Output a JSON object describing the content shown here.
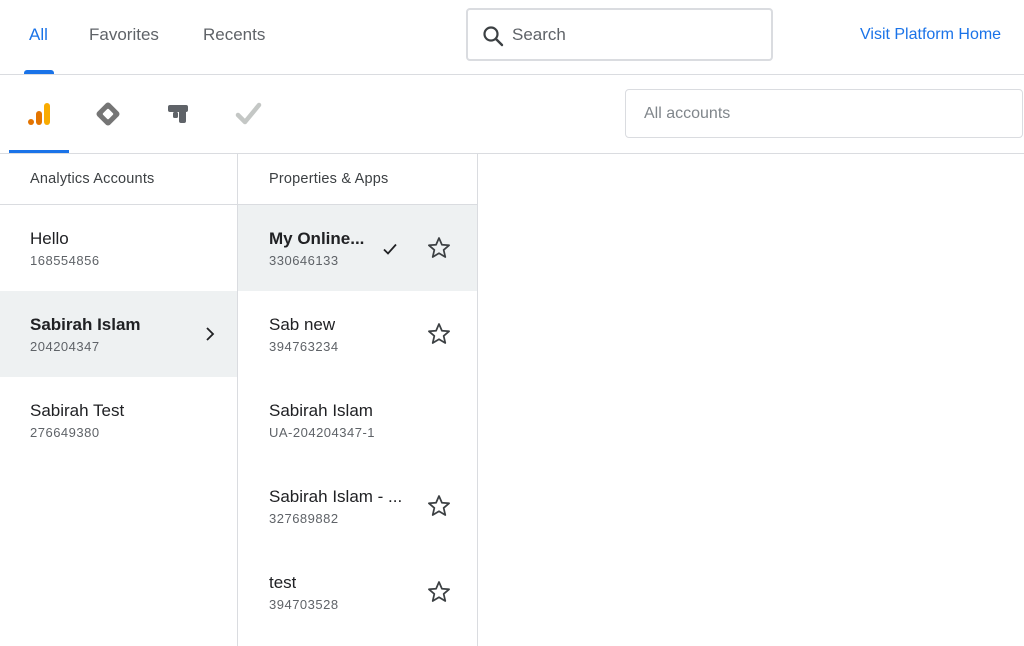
{
  "top_tabs": [
    {
      "label": "All",
      "active": true
    },
    {
      "label": "Favorites",
      "active": false
    },
    {
      "label": "Recents",
      "active": false
    }
  ],
  "search": {
    "placeholder": "Search",
    "icon": "search-icon"
  },
  "visit_link": "Visit Platform Home",
  "products": [
    "analytics-icon",
    "tag-manager-icon",
    "optimize-icon",
    "surveys-icon"
  ],
  "accounts_filter": {
    "placeholder": "All accounts"
  },
  "accounts_column": {
    "header": "Analytics Accounts",
    "items": [
      {
        "name": "Hello",
        "id": "168554856",
        "selected": false
      },
      {
        "name": "Sabirah Islam",
        "id": "204204347",
        "selected": true
      },
      {
        "name": "Sabirah Test",
        "id": "276649380",
        "selected": false
      }
    ]
  },
  "properties_column": {
    "header": "Properties & Apps",
    "items": [
      {
        "name": "My Online...",
        "id": "330646133",
        "selected": true,
        "checked": true,
        "star": true
      },
      {
        "name": "Sab new",
        "id": "394763234",
        "selected": false,
        "checked": false,
        "star": true
      },
      {
        "name": "Sabirah Islam",
        "id": "UA-204204347-1",
        "selected": false,
        "checked": false,
        "star": false
      },
      {
        "name": "Sabirah Islam - ...",
        "id": "327689882",
        "selected": false,
        "checked": false,
        "star": true
      },
      {
        "name": "test",
        "id": "394703528",
        "selected": false,
        "checked": false,
        "star": true
      }
    ]
  },
  "colors": {
    "accent": "#1a73e8",
    "analytics_orange": "#f9ab00",
    "analytics_dark": "#e37400"
  }
}
